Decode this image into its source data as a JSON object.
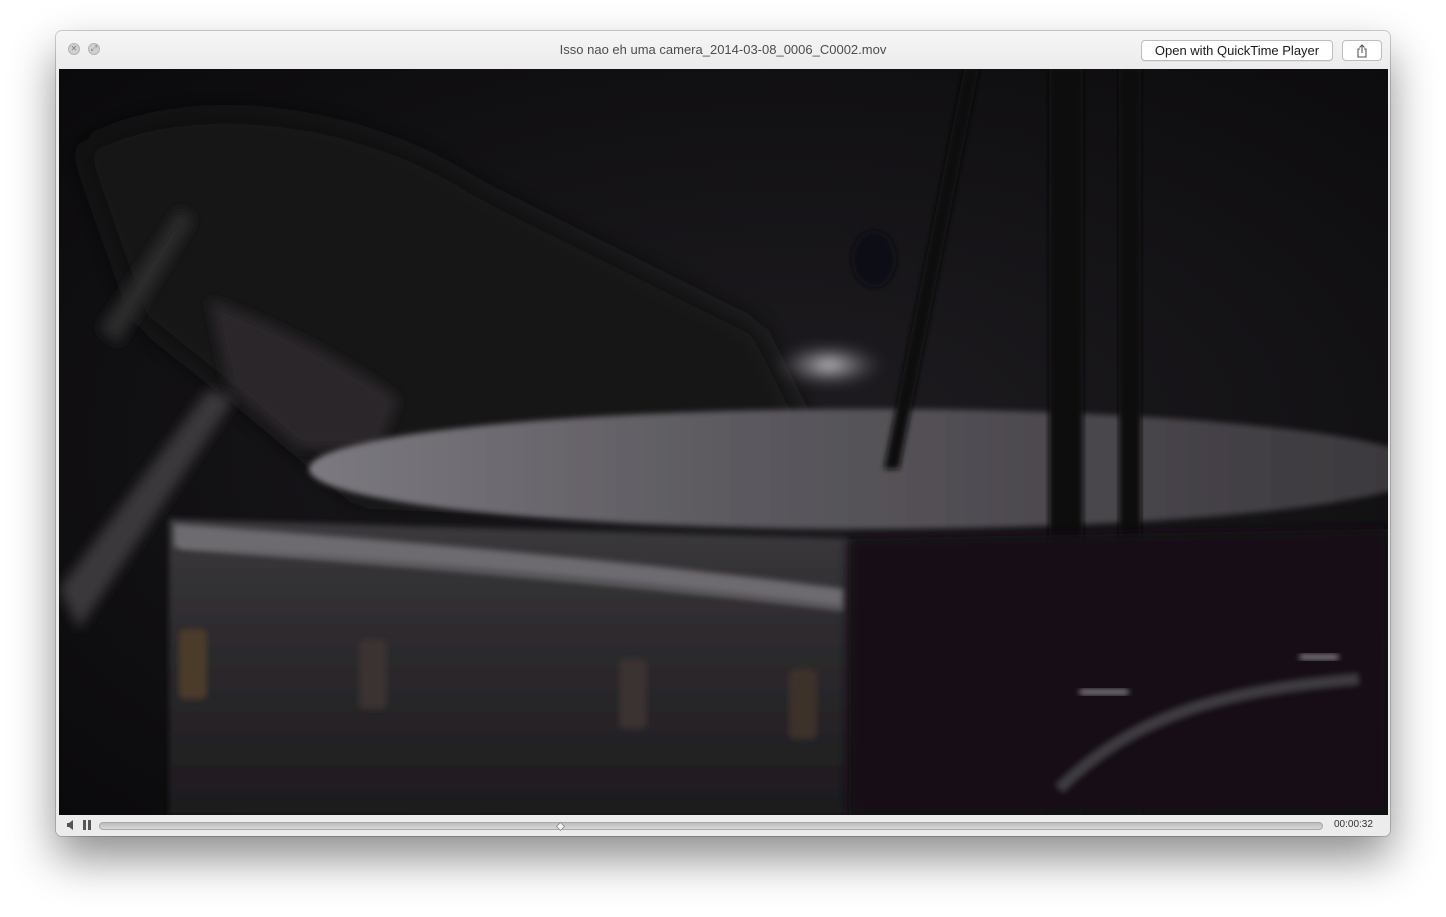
{
  "window": {
    "title": "Isso nao eh uma camera_2014-03-08_0006_C0002.mov"
  },
  "toolbar": {
    "open_label": "Open with QuickTime Player",
    "share_icon": "share-icon"
  },
  "player": {
    "elapsed": "00:00:32",
    "progress": 0.377,
    "state": "playing"
  },
  "colors": {
    "video_bg": "#0e0d0f",
    "chrome": "#ececec"
  }
}
